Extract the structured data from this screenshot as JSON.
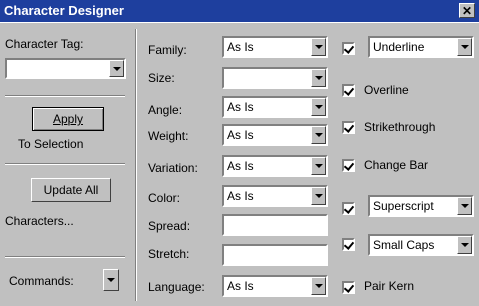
{
  "window": {
    "title": "Character Designer"
  },
  "left": {
    "tag_label": "Character Tag:",
    "tag_value": "",
    "apply_label": "Apply",
    "to_selection": "To Selection",
    "update_all_label": "Update All",
    "characters": "Characters...",
    "commands_label": "Commands:"
  },
  "props": {
    "family": {
      "label": "Family:",
      "value": "As Is"
    },
    "size": {
      "label": "Size:",
      "value": ""
    },
    "angle": {
      "label": "Angle:",
      "value": "As Is"
    },
    "weight": {
      "label": "Weight:",
      "value": "As Is"
    },
    "variation": {
      "label": "Variation:",
      "value": "As Is"
    },
    "color": {
      "label": "Color:",
      "value": "As Is"
    },
    "spread": {
      "label": "Spread:",
      "value": ""
    },
    "stretch": {
      "label": "Stretch:",
      "value": ""
    },
    "language": {
      "label": "Language:",
      "value": "As Is"
    }
  },
  "styles": {
    "underline": "Underline",
    "overline": "Overline",
    "strikethrough": "Strikethrough",
    "change_bar": "Change Bar",
    "superscript": "Superscript",
    "small_caps": "Small Caps",
    "pair_kern": "Pair Kern"
  }
}
